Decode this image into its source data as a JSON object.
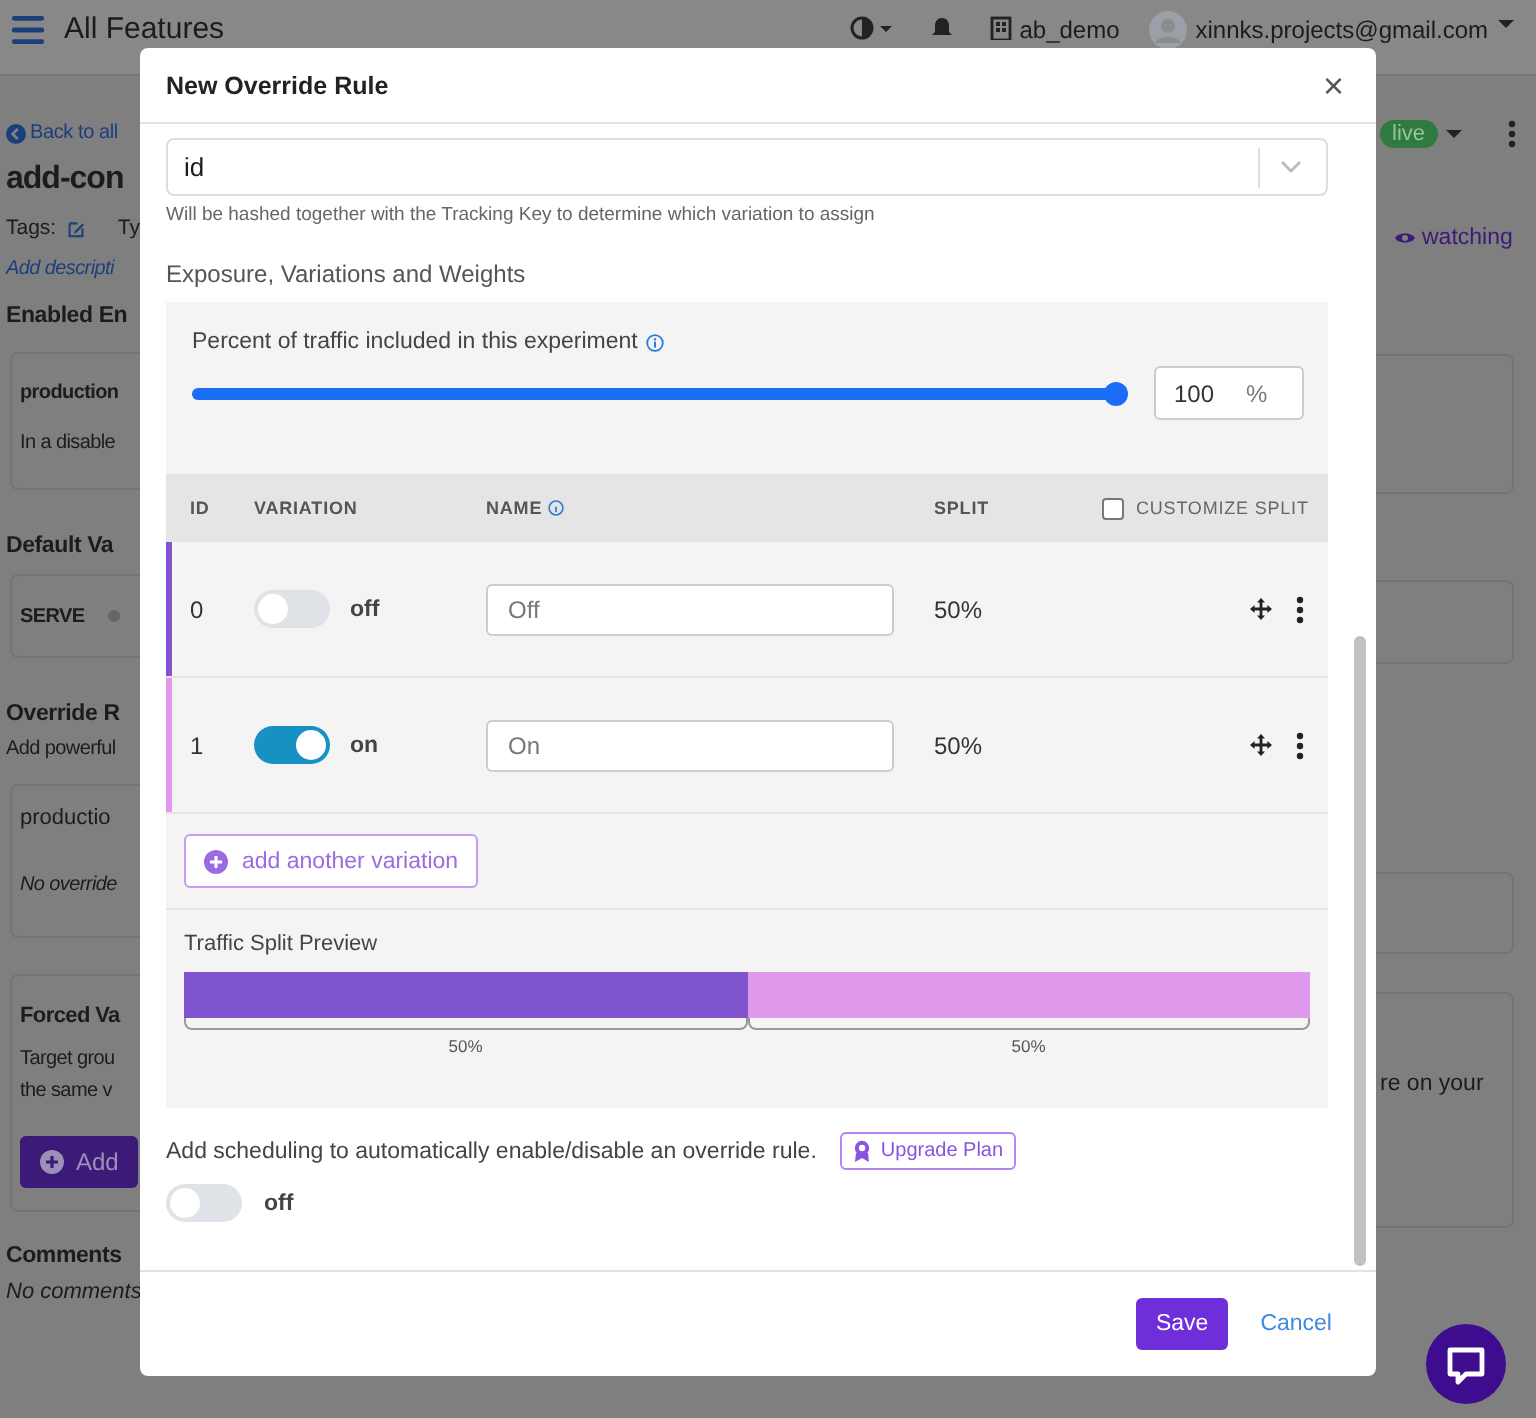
{
  "header": {
    "title": "All Features",
    "org": "ab_demo",
    "account": "xinnks.projects@gmail.com"
  },
  "page_left": {
    "back_link": "Back to all",
    "title": "add-con",
    "tags_label": "Tags:",
    "type_label": "Ty",
    "description_link": "Add descripti",
    "enabled_heading": "Enabled En",
    "enabled_card": {
      "env": "production",
      "text": "In a disable"
    },
    "default_heading": "Default Va",
    "serve_label": "SERVE",
    "override_heading": "Override R",
    "override_text": "Add powerful",
    "override_card": {
      "env": "productio",
      "text": "No override"
    },
    "forced_card": {
      "title": "Forced Va",
      "lines": [
        "Target grou",
        "the same v"
      ],
      "button": "Add"
    },
    "comments_heading": "Comments",
    "comments_text": "No comments"
  },
  "page_right": {
    "status": "live",
    "watch_link": "watching",
    "forced_text": "re on your"
  },
  "modal": {
    "title": "New Override Rule",
    "close": "×",
    "attribute_select": {
      "value": "id",
      "hint": "Will be hashed together with the Tracking Key to determine which variation to assign"
    },
    "section_title": "Exposure, Variations and Weights",
    "coverage": {
      "label": "Percent of traffic included in this experiment",
      "level": 1,
      "value": "100",
      "unit": "%"
    },
    "table": {
      "columns": [
        "ID",
        "VARIATION",
        "NAME",
        "SPLIT"
      ],
      "customize_split": {
        "label": "CUSTOMIZE SPLIT",
        "checked": false
      },
      "rows": [
        {
          "id": "0",
          "on": false,
          "toggle_label": "off",
          "name_placeholder": "Off",
          "split": "50%",
          "color": "#8254d2"
        },
        {
          "id": "1",
          "on": true,
          "toggle_label": "on",
          "name_placeholder": "On",
          "split": "50%",
          "color": "#e199ee"
        }
      ]
    },
    "add_variation": "add another variation",
    "preview": {
      "title": "Traffic Split Preview",
      "segments": [
        {
          "level": 0.5,
          "label": "50%",
          "color": "#8254d2"
        },
        {
          "level": 0.5,
          "label": "50%",
          "color": "#e199ee"
        }
      ]
    },
    "scheduling": {
      "text": "Add scheduling to automatically enable/disable an override rule.",
      "upgrade_button": "Upgrade Plan",
      "on": false,
      "toggle_label": "off"
    },
    "buttons": {
      "save": "Save",
      "cancel": "Cancel"
    }
  }
}
